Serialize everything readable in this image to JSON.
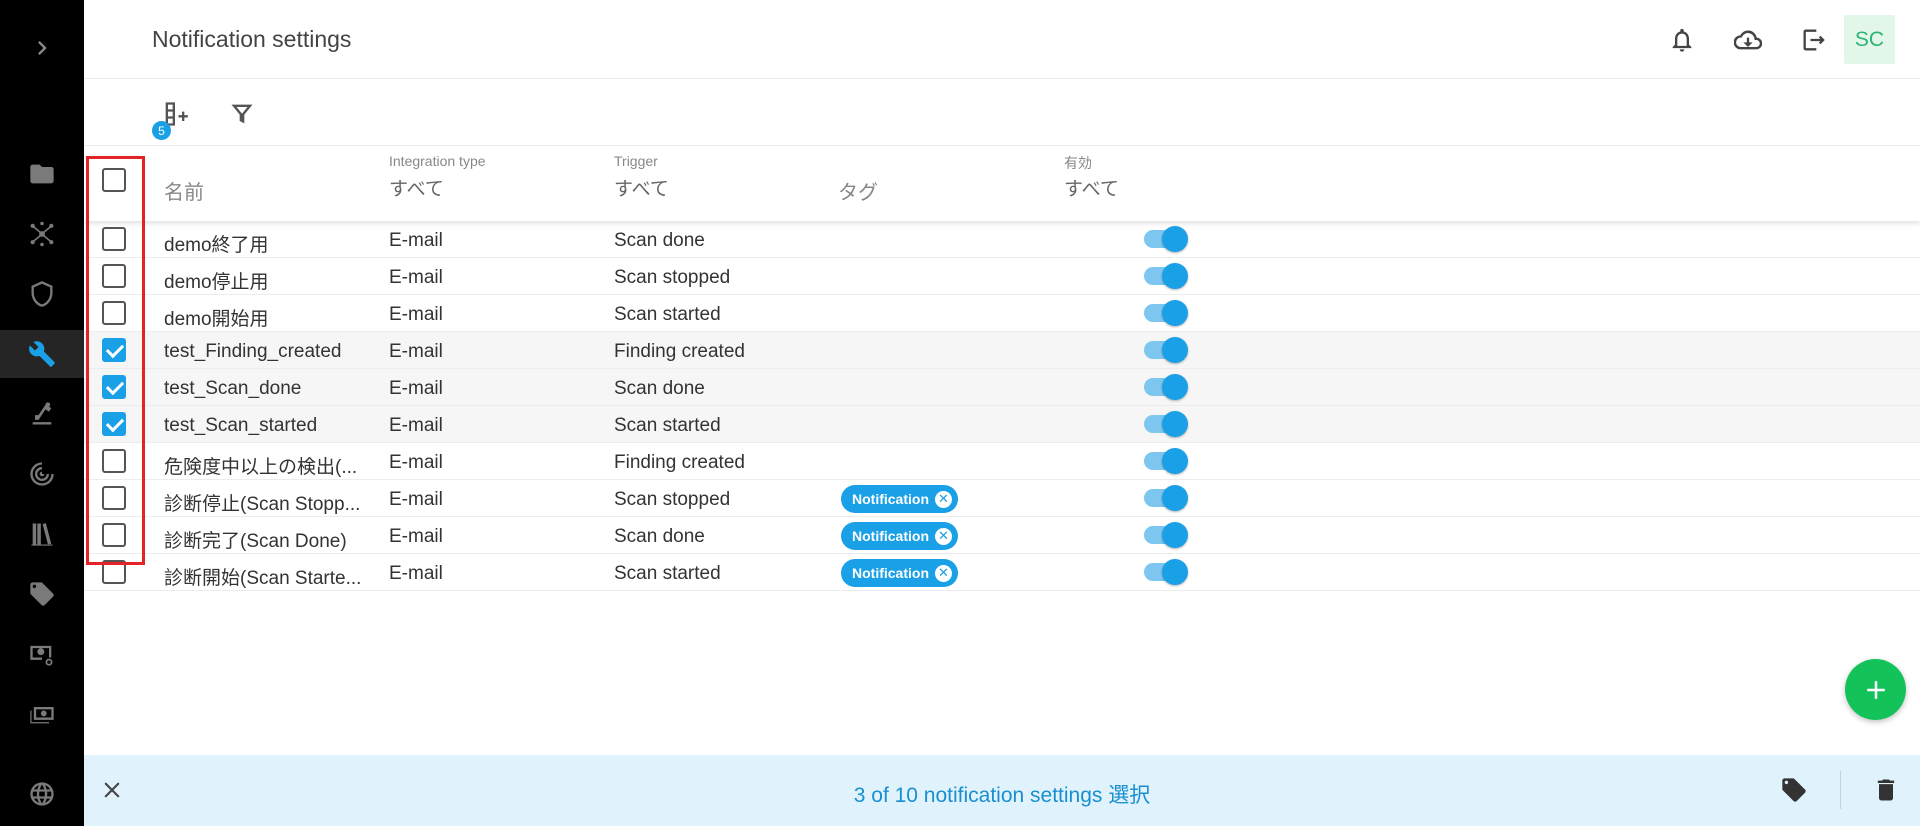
{
  "header": {
    "title": "Notification settings",
    "avatar_initials": "SC"
  },
  "toolbar": {
    "columns_badge": "5"
  },
  "table": {
    "columns": {
      "name": "名前",
      "integration_type_label": "Integration type",
      "integration_type_filter": "すべて",
      "trigger_label": "Trigger",
      "trigger_filter": "すべて",
      "tags": "タグ",
      "enabled_label": "有効",
      "enabled_filter": "すべて"
    },
    "rows": [
      {
        "name": "demo終了用",
        "type": "E-mail",
        "trigger": "Scan done",
        "tag": "",
        "checked": false,
        "enabled": true
      },
      {
        "name": "demo停止用",
        "type": "E-mail",
        "trigger": "Scan stopped",
        "tag": "",
        "checked": false,
        "enabled": true
      },
      {
        "name": "demo開始用",
        "type": "E-mail",
        "trigger": "Scan started",
        "tag": "",
        "checked": false,
        "enabled": true
      },
      {
        "name": "test_Finding_created",
        "type": "E-mail",
        "trigger": "Finding created",
        "tag": "",
        "checked": true,
        "enabled": true
      },
      {
        "name": "test_Scan_done",
        "type": "E-mail",
        "trigger": "Scan done",
        "tag": "",
        "checked": true,
        "enabled": true
      },
      {
        "name": "test_Scan_started",
        "type": "E-mail",
        "trigger": "Scan started",
        "tag": "",
        "checked": true,
        "enabled": true
      },
      {
        "name": "危険度中以上の検出(...",
        "type": "E-mail",
        "trigger": "Finding created",
        "tag": "",
        "checked": false,
        "enabled": true
      },
      {
        "name": "診断停止(Scan Stopp...",
        "type": "E-mail",
        "trigger": "Scan stopped",
        "tag": "Notification",
        "checked": false,
        "enabled": true
      },
      {
        "name": "診断完了(Scan Done)",
        "type": "E-mail",
        "trigger": "Scan done",
        "tag": "Notification",
        "checked": false,
        "enabled": true
      },
      {
        "name": "診断開始(Scan Starte...",
        "type": "E-mail",
        "trigger": "Scan started",
        "tag": "Notification",
        "checked": false,
        "enabled": true
      }
    ]
  },
  "selection_bar": {
    "text": "3 of 10 notification settings 選択"
  },
  "icons": {
    "nav": [
      "chevron-right-icon",
      "folder-icon",
      "network-icon",
      "shield-icon",
      "wrench-icon",
      "scanner-icon",
      "radar-icon",
      "library-icon",
      "tag-icon",
      "cash-sync-icon",
      "cash-multiple-icon",
      "globe-icon"
    ],
    "header": [
      "bell-icon",
      "cloud-download-icon",
      "logout-icon"
    ]
  },
  "colors": {
    "accent": "#1aa0e6",
    "fab": "#13c35a",
    "highlight": "#e32326",
    "selection_bar": "#e0f3fc"
  }
}
